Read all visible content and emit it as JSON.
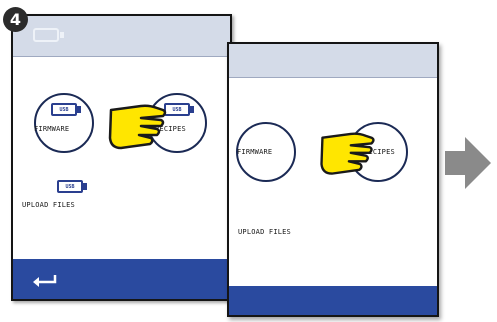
{
  "step": {
    "number": "4"
  },
  "back_screen": {
    "options": [
      {
        "label": "FIRMWARE",
        "badge": "USB"
      },
      {
        "label": "RECIPES",
        "badge": "USB"
      }
    ],
    "upload": {
      "label": "UPLOAD FILES",
      "badge": "USB"
    }
  },
  "front_screen": {
    "options": [
      {
        "label": "FIRMWARE"
      },
      {
        "label": "RECIPES"
      }
    ],
    "upload": {
      "label": "UPLOAD FILES"
    }
  },
  "colors": {
    "topbar": "#d4dbe8",
    "bottombar": "#2a4a9f",
    "hand": "#ffe600",
    "arrow": "#8a8a8a"
  },
  "icons": [
    "usb-icon",
    "pointing-hand-icon",
    "return-arrow-icon",
    "next-arrow-icon"
  ]
}
